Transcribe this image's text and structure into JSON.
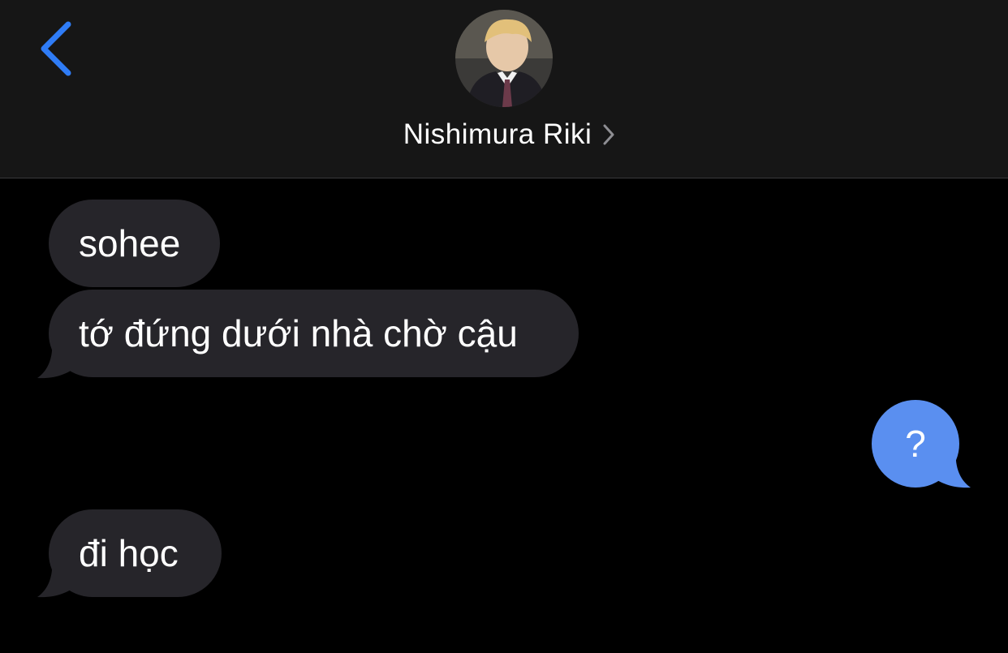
{
  "header": {
    "back_icon": "chevron-left-icon",
    "contact_name": "Nishimura Riki",
    "contact_chevron_icon": "chevron-right-icon",
    "avatar_icon": "contact-avatar-photo"
  },
  "messages": [
    {
      "direction": "incoming",
      "text": "sohee"
    },
    {
      "direction": "incoming",
      "text": "tớ đứng dưới nhà chờ cậu"
    },
    {
      "direction": "outgoing",
      "text": "?"
    },
    {
      "direction": "incoming",
      "text": "đi học"
    }
  ],
  "colors": {
    "background": "#000000",
    "header_background": "#161616",
    "incoming_bubble": "#26252a",
    "outgoing_bubble": "#5a8ff0",
    "accent_blue": "#2f7cf6"
  }
}
